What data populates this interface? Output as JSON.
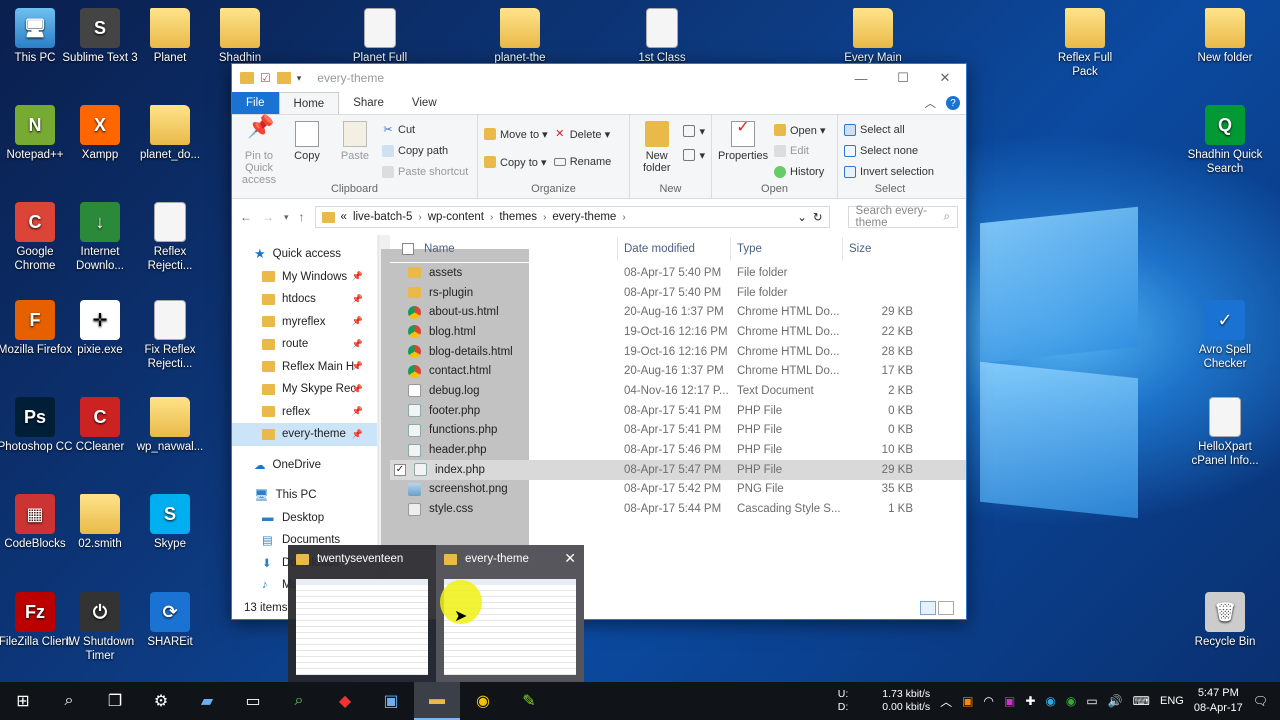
{
  "desktop": {
    "icons": [
      {
        "label": "This PC",
        "glyph": "🖥"
      },
      {
        "label": "Sublime Text 3",
        "glyph": "S"
      },
      {
        "label": "Planet",
        "glyph": ""
      },
      {
        "label": "Shadhin",
        "glyph": ""
      },
      {
        "label": "Planet Full",
        "glyph": ""
      },
      {
        "label": "planet-the",
        "glyph": ""
      },
      {
        "label": "1st Class",
        "glyph": ""
      },
      {
        "label": "Every Main",
        "glyph": ""
      },
      {
        "label": "Reflex Full Pack",
        "glyph": ""
      },
      {
        "label": "New folder",
        "glyph": ""
      },
      {
        "label": "Notepad++",
        "glyph": "N"
      },
      {
        "label": "Xampp",
        "glyph": "X"
      },
      {
        "label": "planet_do...",
        "glyph": ""
      },
      {
        "label": "Shadhin Quick Search",
        "glyph": "Q"
      },
      {
        "label": "Google Chrome",
        "glyph": "C"
      },
      {
        "label": "Internet Downlo...",
        "glyph": "↓"
      },
      {
        "label": "Reflex Rejecti...",
        "glyph": ""
      },
      {
        "label": "Mozilla Firefox",
        "glyph": "F"
      },
      {
        "label": "pixie.exe",
        "glyph": "✛"
      },
      {
        "label": "Fix Reflex Rejecti...",
        "glyph": ""
      },
      {
        "label": "Avro Spell Checker",
        "glyph": "✓"
      },
      {
        "label": "Photoshop CC",
        "glyph": "Ps"
      },
      {
        "label": "CCleaner",
        "glyph": "C"
      },
      {
        "label": "wp_navwal...",
        "glyph": ""
      },
      {
        "label": "HelloXpart cPanel Info...",
        "glyph": ""
      },
      {
        "label": "CodeBlocks",
        "glyph": "▦"
      },
      {
        "label": "02.smith",
        "glyph": ""
      },
      {
        "label": "Skype",
        "glyph": "S"
      },
      {
        "label": "FileZilla Client",
        "glyph": "Fz"
      },
      {
        "label": "IW Shutdown Timer",
        "glyph": "⏻"
      },
      {
        "label": "SHAREit",
        "glyph": "⟳"
      },
      {
        "label": "Recycle Bin",
        "glyph": "🗑"
      }
    ]
  },
  "window": {
    "title": "every-theme",
    "controls": {
      "minimize": "—",
      "maximize": "☐",
      "close": "✕"
    },
    "tabs": [
      "File",
      "Home",
      "Share",
      "View"
    ],
    "ribbon": {
      "clipboard": {
        "label": "Clipboard",
        "pin": "Pin to Quick access",
        "copy": "Copy",
        "paste": "Paste",
        "cut": "Cut",
        "copy_path": "Copy path",
        "paste_shortcut": "Paste shortcut"
      },
      "organize": {
        "label": "Organize",
        "move_to": "Move to ▾",
        "copy_to": "Copy to ▾",
        "delete": "Delete ▾",
        "rename": "Rename"
      },
      "new": {
        "label": "New",
        "new_folder": "New folder"
      },
      "open": {
        "label": "Open",
        "properties": "Properties",
        "open": "Open ▾",
        "edit": "Edit",
        "history": "History"
      },
      "select": {
        "label": "Select",
        "select_all": "Select all",
        "select_none": "Select none",
        "invert": "Invert selection"
      }
    },
    "address": {
      "crumbs": [
        "«",
        "live-batch-5",
        "wp-content",
        "themes",
        "every-theme"
      ],
      "search_placeholder": "Search every-theme"
    },
    "nav": {
      "quick_access": "Quick access",
      "items": [
        "My Windows",
        "htdocs",
        "myreflex",
        "route",
        "Reflex Main H",
        "My Skype Rec",
        "reflex",
        "every-theme"
      ],
      "onedrive": "OneDrive",
      "thispc": "This PC",
      "pc_items": [
        "Desktop",
        "Documents",
        "Downloads",
        "Music"
      ]
    },
    "columns": {
      "name": "Name",
      "date": "Date modified",
      "type": "Type",
      "size": "Size"
    },
    "files": [
      {
        "name": "assets",
        "date": "08-Apr-17 5:40 PM",
        "type": "File folder",
        "size": "",
        "icon": "folder"
      },
      {
        "name": "rs-plugin",
        "date": "08-Apr-17 5:40 PM",
        "type": "File folder",
        "size": "",
        "icon": "folder"
      },
      {
        "name": "about-us.html",
        "date": "20-Aug-16 1:37 PM",
        "type": "Chrome HTML Do...",
        "size": "29 KB",
        "icon": "chrome"
      },
      {
        "name": "blog.html",
        "date": "19-Oct-16 12:16 PM",
        "type": "Chrome HTML Do...",
        "size": "22 KB",
        "icon": "chrome"
      },
      {
        "name": "blog-details.html",
        "date": "19-Oct-16 12:16 PM",
        "type": "Chrome HTML Do...",
        "size": "28 KB",
        "icon": "chrome"
      },
      {
        "name": "contact.html",
        "date": "20-Aug-16 1:37 PM",
        "type": "Chrome HTML Do...",
        "size": "17 KB",
        "icon": "chrome"
      },
      {
        "name": "debug.log",
        "date": "04-Nov-16 12:17 P...",
        "type": "Text Document",
        "size": "2 KB",
        "icon": "txt"
      },
      {
        "name": "footer.php",
        "date": "08-Apr-17 5:41 PM",
        "type": "PHP File",
        "size": "0 KB",
        "icon": "php"
      },
      {
        "name": "functions.php",
        "date": "08-Apr-17 5:41 PM",
        "type": "PHP File",
        "size": "0 KB",
        "icon": "php"
      },
      {
        "name": "header.php",
        "date": "08-Apr-17 5:46 PM",
        "type": "PHP File",
        "size": "10 KB",
        "icon": "php"
      },
      {
        "name": "index.php",
        "date": "08-Apr-17 5:47 PM",
        "type": "PHP File",
        "size": "29 KB",
        "icon": "php",
        "selected": true
      },
      {
        "name": "screenshot.png",
        "date": "08-Apr-17 5:42 PM",
        "type": "PNG File",
        "size": "35 KB",
        "icon": "png"
      },
      {
        "name": "style.css",
        "date": "08-Apr-17 5:44 PM",
        "type": "Cascading Style S...",
        "size": "1 KB",
        "icon": "css"
      }
    ],
    "status": "13 items"
  },
  "thumbnails": [
    {
      "title": "twentyseventeen"
    },
    {
      "title": "every-theme",
      "close": "✕"
    }
  ],
  "taskbar": {
    "net_up_label": "U:",
    "net_down_label": "D:",
    "net_up": "1.73 kbit/s",
    "net_down": "0.00 kbit/s",
    "lang": "ENG",
    "time": "5:47 PM",
    "date": "08-Apr-17"
  }
}
